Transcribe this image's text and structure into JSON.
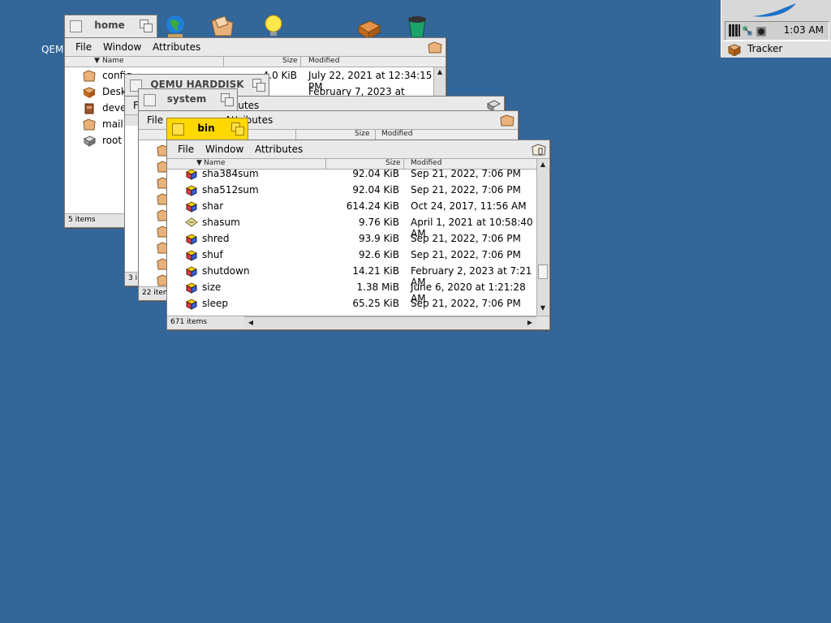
{
  "desktop": {
    "label_qemu": "QEMU",
    "icons": [
      "globe-icon",
      "folder-icon",
      "lightbulb-icon",
      "package-icon",
      "trash-icon"
    ]
  },
  "deskbar": {
    "clock": "1:03 AM",
    "tracker_label": "Tracker",
    "logo": "feather-logo"
  },
  "menu": {
    "file": "File",
    "window": "Window",
    "attributes": "Attributes"
  },
  "columns": {
    "name": "Name",
    "size": "Size",
    "modified": "Modified"
  },
  "home": {
    "title": "home",
    "status": "5 items",
    "items": [
      {
        "name": "config",
        "size": "4.0 KiB",
        "modified": "July 22, 2021 at 12:34:15 PM",
        "icon": "folder-icon"
      },
      {
        "name": "Desktop",
        "size": "",
        "modified": "February 7, 2023 at 12:58 AM",
        "icon": "desktop-icon"
      },
      {
        "name": "develop",
        "size": "",
        "modified": "",
        "icon": "package-icon"
      },
      {
        "name": "mail",
        "size": "",
        "modified": "",
        "icon": "folder-icon"
      },
      {
        "name": "root",
        "size": "",
        "modified": "",
        "icon": "disk-icon"
      }
    ]
  },
  "harddisk": {
    "title": "QEMU HARDDISK",
    "status": "3 i"
  },
  "system": {
    "title": "system",
    "status": "22 item"
  },
  "bin": {
    "title": "bin",
    "status": "671 items",
    "items": [
      {
        "name": "sha384sum",
        "size": "92.04 KiB",
        "modified": "Sep 21, 2022, 7:06 PM",
        "icon": "app-icon"
      },
      {
        "name": "sha512sum",
        "size": "92.04 KiB",
        "modified": "Sep 21, 2022, 7:06 PM",
        "icon": "app-icon"
      },
      {
        "name": "shar",
        "size": "614.24 KiB",
        "modified": "Oct 24, 2017, 11:56 AM",
        "icon": "app-icon"
      },
      {
        "name": "shasum",
        "size": "9.76 KiB",
        "modified": "April 1, 2021 at 10:58:40 AM",
        "icon": "script-icon"
      },
      {
        "name": "shred",
        "size": "93.9 KiB",
        "modified": "Sep 21, 2022, 7:06 PM",
        "icon": "app-icon"
      },
      {
        "name": "shuf",
        "size": "92.6 KiB",
        "modified": "Sep 21, 2022, 7:06 PM",
        "icon": "app-icon"
      },
      {
        "name": "shutdown",
        "size": "14.21 KiB",
        "modified": "February 2, 2023 at 7:21 AM",
        "icon": "app-icon"
      },
      {
        "name": "size",
        "size": "1.38 MiB",
        "modified": "June 6, 2020 at 1:21:28 AM",
        "icon": "app-icon"
      },
      {
        "name": "sleep",
        "size": "65.25 KiB",
        "modified": "Sep 21, 2022, 7:06 PM",
        "icon": "app-icon"
      }
    ]
  },
  "colors": {
    "desktop": "#336699",
    "active_tab": "#ffd800",
    "window": "#e4e4e4"
  }
}
